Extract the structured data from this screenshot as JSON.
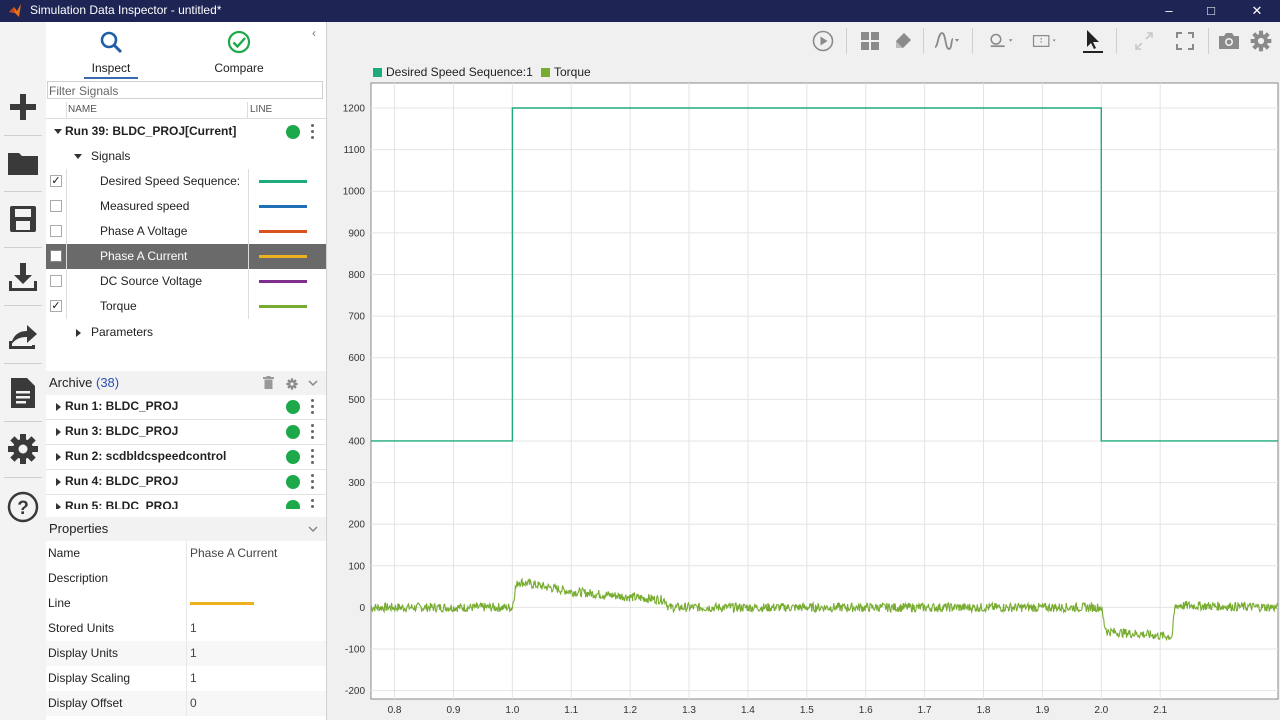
{
  "window": {
    "title": "Simulation Data Inspector - untitled*"
  },
  "tabs": {
    "inspect": "Inspect",
    "compare": "Compare"
  },
  "filter": {
    "placeholder": "Filter Signals"
  },
  "columns": {
    "name": "NAME",
    "line": "LINE"
  },
  "current_run": {
    "label": "Run 39: BLDC_PROJ[Current]"
  },
  "signals_group": "Signals",
  "parameters_group": "Parameters",
  "signals": [
    {
      "name": "Desired Speed Sequence:1",
      "checked": true,
      "color": "#1dab7a"
    },
    {
      "name": "Measured speed",
      "checked": false,
      "color": "#1f6fb5"
    },
    {
      "name": "Phase A Voltage",
      "checked": false,
      "color": "#d9531e"
    },
    {
      "name": "Phase A Current",
      "checked": false,
      "color": "#edb120",
      "selected": true
    },
    {
      "name": "DC Source Voltage",
      "checked": false,
      "color": "#7e2f8e"
    },
    {
      "name": "Torque",
      "checked": true,
      "color": "#77ac30"
    }
  ],
  "archive": {
    "title": "Archive",
    "count": "(38)",
    "runs": [
      {
        "label": "Run 1: BLDC_PROJ"
      },
      {
        "label": "Run 3: BLDC_PROJ"
      },
      {
        "label": "Run 2: scdbldcspeedcontrol"
      },
      {
        "label": "Run 4: BLDC_PROJ"
      },
      {
        "label": "Run 5: BLDC_PROJ"
      }
    ]
  },
  "properties": {
    "title": "Properties",
    "rows": [
      {
        "key": "Name",
        "value": "Phase A Current"
      },
      {
        "key": "Description",
        "value": ""
      },
      {
        "key": "Line",
        "value": ""
      },
      {
        "key": "Stored Units",
        "value": "1"
      },
      {
        "key": "Display Units",
        "value": "1"
      },
      {
        "key": "Display Scaling",
        "value": "1"
      },
      {
        "key": "Display Offset",
        "value": "0"
      }
    ],
    "line_color": "#edb120"
  },
  "legend": [
    {
      "name": "Desired Speed Sequence:1",
      "color": "#1dab7a"
    },
    {
      "name": "Torque",
      "color": "#77ac30"
    }
  ],
  "chart_data": {
    "type": "line",
    "xlim": [
      0.76,
      2.3
    ],
    "ylim": [
      -220,
      1260
    ],
    "xticks": [
      "0.8",
      "0.9",
      "1.0",
      "1.1",
      "1.2",
      "1.3",
      "1.4",
      "1.5",
      "1.6",
      "1.7",
      "1.8",
      "1.9",
      "2.0",
      "2.1"
    ],
    "xtick_values": [
      0.8,
      0.9,
      1.0,
      1.1,
      1.2,
      1.3,
      1.4,
      1.5,
      1.6,
      1.7,
      1.8,
      1.9,
      2.0,
      2.1
    ],
    "yticks": [
      "-200",
      "-100",
      "0",
      "100",
      "200",
      "300",
      "400",
      "500",
      "600",
      "700",
      "800",
      "900",
      "1000",
      "1100",
      "1200"
    ],
    "ytick_values": [
      -200,
      -100,
      0,
      100,
      200,
      300,
      400,
      500,
      600,
      700,
      800,
      900,
      1000,
      1100,
      1200
    ],
    "grid": true,
    "series": [
      {
        "name": "Desired Speed Sequence:1",
        "color": "#1dab7a",
        "x": [
          0.76,
          1.0,
          1.0,
          2.0,
          2.0,
          2.3
        ],
        "y": [
          400,
          400,
          1200,
          1200,
          400,
          400
        ]
      },
      {
        "name": "Torque",
        "color": "#77ac30",
        "x": [
          0.76,
          1.0,
          1.005,
          1.01,
          1.1,
          1.2,
          1.26,
          1.265,
          1.4,
          1.6,
          1.8,
          2.0,
          2.005,
          2.01,
          2.1,
          2.12,
          2.125,
          2.13,
          2.3
        ],
        "y": [
          0,
          0,
          45,
          62,
          38,
          25,
          18,
          0,
          0,
          0,
          0,
          0,
          -40,
          -58,
          -68,
          -70,
          0,
          5,
          0
        ]
      }
    ]
  }
}
